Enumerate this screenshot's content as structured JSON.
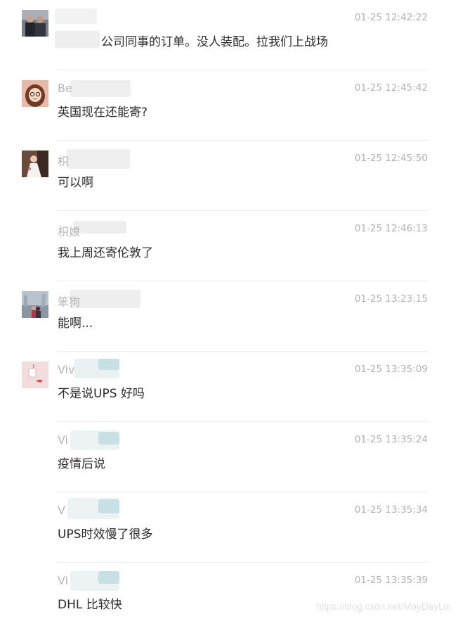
{
  "messages": [
    {
      "sender": "",
      "time": "01-25 12:42:22",
      "text": "公司同事的订单。没人装配。拉我们上战场",
      "avatar": "avatar-photo-man-icon"
    },
    {
      "sender": "Be",
      "time": "01-25 12:45:42",
      "text": "英国现在还能寄?",
      "avatar": "avatar-cartoon-girl-icon"
    },
    {
      "sender": "枳",
      "time": "01-25 12:45:50",
      "text": "可以啊",
      "avatar": "avatar-photo-bride-icon"
    },
    {
      "sender": "枳娘",
      "time": "01-25 12:46:13",
      "text": "我上周还寄伦敦了",
      "avatar": ""
    },
    {
      "sender": "笨狗",
      "time": "01-25 13:23:15",
      "text": "能啊...",
      "avatar": "avatar-photo-city-icon"
    },
    {
      "sender": "Viv",
      "time": "01-25 13:35:09",
      "text": "不是说UPS 好吗",
      "avatar": "avatar-pink-illustration-icon"
    },
    {
      "sender": "Vi",
      "time": "01-25 13:35:24",
      "text": "疫情后说",
      "avatar": ""
    },
    {
      "sender": "V",
      "time": "01-25 13:35:34",
      "text": "UPS时效慢了很多",
      "avatar": ""
    },
    {
      "sender": "Vi",
      "time": "01-25 13:35:39",
      "text": "DHL 比较快",
      "avatar": ""
    }
  ],
  "watermark": "https://blog.csdn.net/MayDayLin",
  "colors": {
    "sender": "#b4b4b4",
    "time": "#b2b2b2",
    "text": "#2b2b2b",
    "divider": "#ececec"
  }
}
